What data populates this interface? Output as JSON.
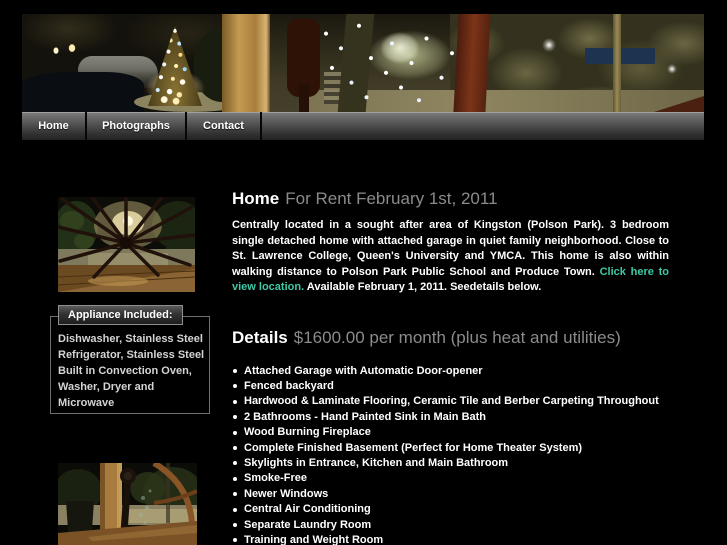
{
  "nav": {
    "items": [
      {
        "label": "Home"
      },
      {
        "label": "Photographs"
      },
      {
        "label": "Contact"
      }
    ]
  },
  "intro": {
    "title": "Home",
    "subtitle": "For Rent February 1st, 2011",
    "body_before_link": "Centrally located in a sought after area of Kingston (Polson Park). 3 bedroom single detached home with attached garage in quiet family neighborhood. Close to St. Lawrence College, Queen's University and YMCA. This home is also within walking distance to Polson Park Public School and Produce Town. ",
    "link_text": "Click here to view location.",
    "body_after_link": " Available February 1, 2011. Seedetails below."
  },
  "details": {
    "title": "Details",
    "subtitle": "$1600.00 per month (plus heat and utilities)",
    "items": [
      "Attached Garage with Automatic Door-opener",
      "Fenced backyard",
      "Hardwood & Laminate Flooring, Ceramic Tile and Berber Carpeting Throughout",
      "2 Bathrooms - Hand Painted Sink in Main Bath",
      "Wood Burning Fireplace",
      "Complete Finished Basement (Perfect for Home Theater System)",
      "Skylights in Entrance, Kitchen and Main Bathroom",
      "Smoke-Free",
      "Newer Windows",
      "Central Air Conditioning",
      "Separate Laundry Room",
      "Training and Weight Room"
    ]
  },
  "sidebar": {
    "appliance_label": "Appliance Included:",
    "appliance_text": "Dishwasher, Stainless Steel\nRefrigerator, Stainless Steel\nBuilt in Convection Oven,\nWasher, Dryer and\nMicrowave"
  },
  "colors": {
    "link_accent": "#3fc9a6",
    "subtitle_gray": "#8b8b8b",
    "page_background": "#000000"
  }
}
